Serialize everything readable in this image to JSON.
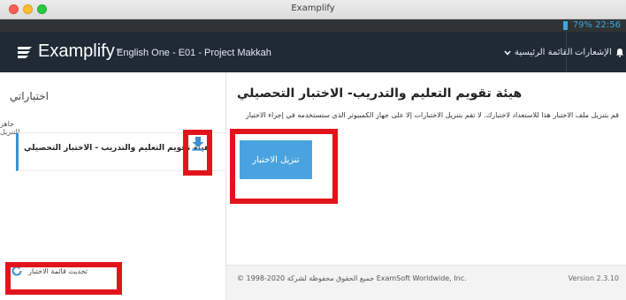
{
  "window": {
    "title": "Examplify"
  },
  "status": {
    "battery_time": "79% 22:56"
  },
  "navbar": {
    "logo": "Examplify",
    "course": "English One - E01 - Project Makkah",
    "menu_label": "القائمة الرئيسية",
    "notifications_label": "الإشعارات"
  },
  "sidebar": {
    "title": "اختباراتي",
    "subtitle": "جاهز للتنزيل",
    "exam_name": "هيئة تقويم التعليم والتدريب - الاختبار التحصيلي",
    "refresh_label": "تحديث قائمة الاختبار"
  },
  "main": {
    "title": "هيئة تقويم التعليم والتدريب- الاختبار التحصيلي",
    "description": "قم بتنزيل ملف الاختبار هذا للاستعداد لاختبارك. لا تقم بتنزيل الاختبارات إلا على جهاز الكمبيوتر الذي ستستخدمه في إجراء الاختبار",
    "download_button": "تنزيل الاختبار"
  },
  "footer": {
    "copyright": "© 1998-2020 جميع الحقوق محفوظة لشركة ExamSoft Worldwide, Inc.",
    "version": "Version 2.3.10"
  },
  "colors": {
    "navbar": "#1f2a35",
    "accent": "#4aa3df",
    "highlight": "#e2141b"
  }
}
